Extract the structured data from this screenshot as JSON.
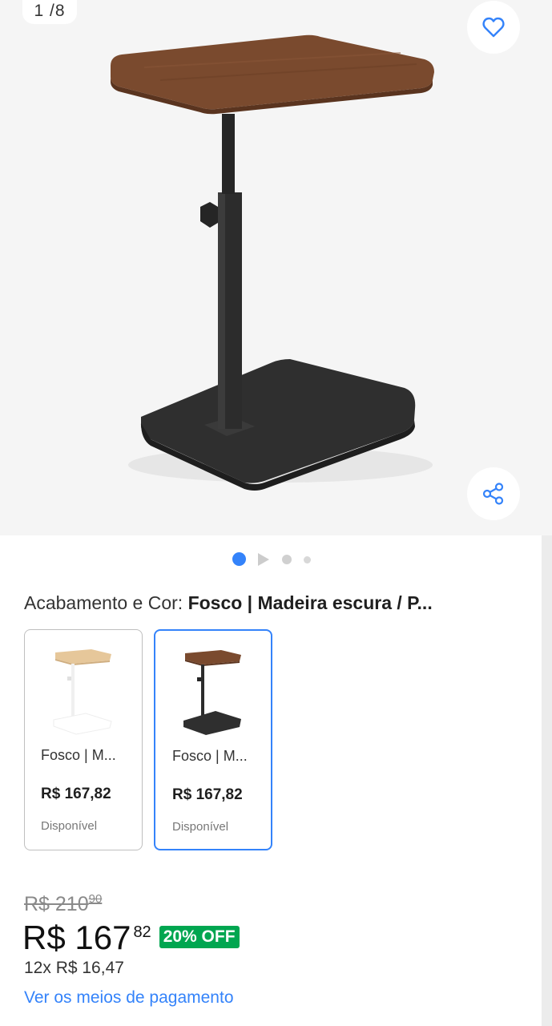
{
  "gallery": {
    "counter": "1 /8",
    "image_name": "side-table-dark-wood",
    "favorite_icon": "heart-outline-icon",
    "share_icon": "share-icon",
    "pagination": [
      "active-dot",
      "video-play-dot",
      "dot",
      "dot"
    ],
    "accent": "#3483fa"
  },
  "variant": {
    "label": "Acabamento e Cor: ",
    "selected_value": "Fosco | Madeira escura / P...",
    "options": [
      {
        "name": "Fosco | M...",
        "price": "R$ 167,82",
        "status": "Disponível",
        "selected": false
      },
      {
        "name": "Fosco | M...",
        "price": "R$ 167,82",
        "status": "Disponível",
        "selected": true
      }
    ]
  },
  "price": {
    "original_whole": "R$ 210",
    "original_cents": "90",
    "current_whole": "R$ 167",
    "current_cents": "82",
    "discount": "20% OFF",
    "discount_color": "#00a650",
    "installments": "12x R$ 16,47",
    "payment_link": "Ver os meios de pagamento",
    "link_color": "#3483fa"
  }
}
